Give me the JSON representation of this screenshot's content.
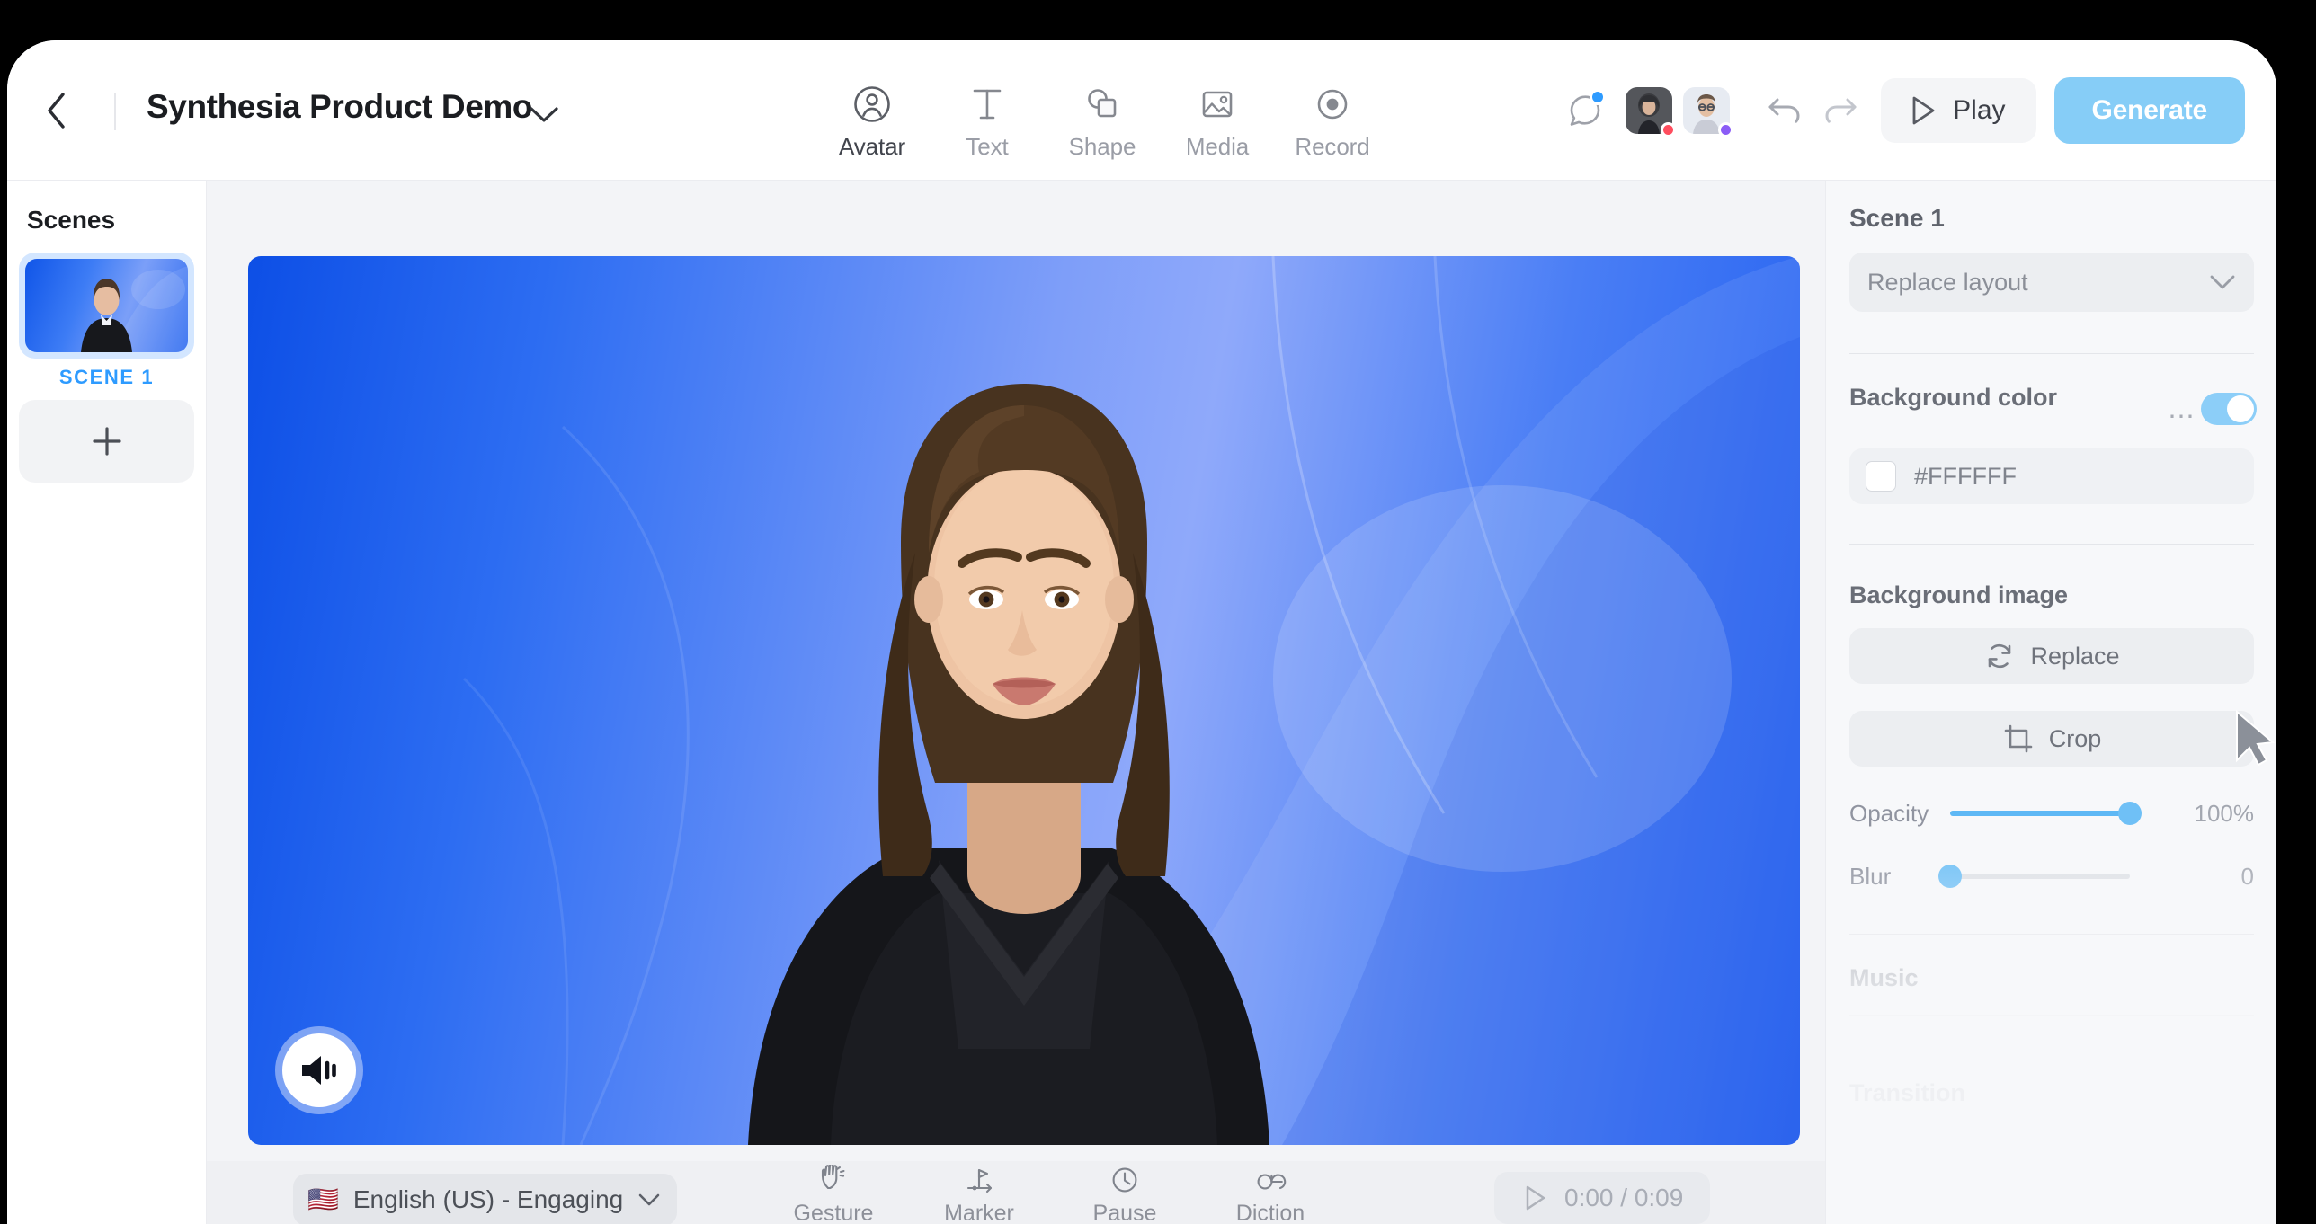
{
  "header": {
    "back_icon": "chevron-left-icon",
    "title": "Synthesia Product Demo",
    "title_chevron_icon": "chevron-down-icon",
    "tools": [
      {
        "label": "Avatar",
        "icon": "avatar-person-circle-icon"
      },
      {
        "label": "Text",
        "icon": "text-t-icon"
      },
      {
        "label": "Shape",
        "icon": "shape-circle-square-icon"
      },
      {
        "label": "Media",
        "icon": "media-image-icon"
      },
      {
        "label": "Record",
        "icon": "record-dot-circle-icon"
      }
    ],
    "comment_icon": "comment-bubble-icon",
    "comment_badge_color": "#2E9BFF",
    "collaborators": [
      {
        "name": "collaborator-1",
        "status_color": "#FF4D5E"
      },
      {
        "name": "collaborator-2",
        "status_color": "#8B5CF6"
      }
    ],
    "undo_icon": "undo-arrow-icon",
    "redo_icon": "redo-arrow-icon",
    "play_label": "Play",
    "play_icon": "play-triangle-icon",
    "generate_label": "Generate",
    "generate_color": "#86CDF7"
  },
  "sidebar": {
    "title": "Scenes",
    "scenes": [
      {
        "label": "SCENE 1",
        "selected": true,
        "label_color": "#2E9BFF"
      }
    ],
    "add_scene_icon": "plus-icon"
  },
  "canvas": {
    "audio_button_icon": "speaker-volume-icon",
    "background_gradient_from": "#0D4FE6",
    "background_gradient_to": "#8FA9FA"
  },
  "right_panel": {
    "scene_title": "Scene 1",
    "replace_layout": {
      "label": "Replace layout",
      "chevron_icon": "chevron-down-icon"
    },
    "background_color": {
      "section_label": "Background color",
      "hex_value": "#FFFFFF",
      "swatch_color": "#FFFFFF"
    },
    "background_image": {
      "section_label": "Background image",
      "overflow_icon": "ellipsis-icon",
      "toggle_on": true,
      "toggle_color": "#8CCEF8",
      "replace_label": "Replace",
      "replace_icon": "refresh-cycle-icon",
      "crop_label": "Crop",
      "crop_icon": "crop-icon",
      "opacity_label": "Opacity",
      "opacity_value": "100%",
      "opacity_percent": 100,
      "blur_label": "Blur",
      "blur_value": "0",
      "blur_percent": 0
    },
    "music_label": "Music",
    "transition_label": "Transition"
  },
  "bottom_bar": {
    "language": {
      "flag": "🇺🇸",
      "label": "English (US) - Engaging",
      "chevron_icon": "chevron-down-icon"
    },
    "script_tools": [
      {
        "label": "Gesture",
        "icon": "hand-gesture-icon"
      },
      {
        "label": "Marker",
        "icon": "flag-marker-icon"
      },
      {
        "label": "Pause",
        "icon": "clock-pause-icon"
      },
      {
        "label": "Diction",
        "icon": "ae-ligature-diction-icon"
      }
    ],
    "playback": {
      "play_icon": "play-triangle-icon",
      "time": "0:00 / 0:09"
    }
  }
}
